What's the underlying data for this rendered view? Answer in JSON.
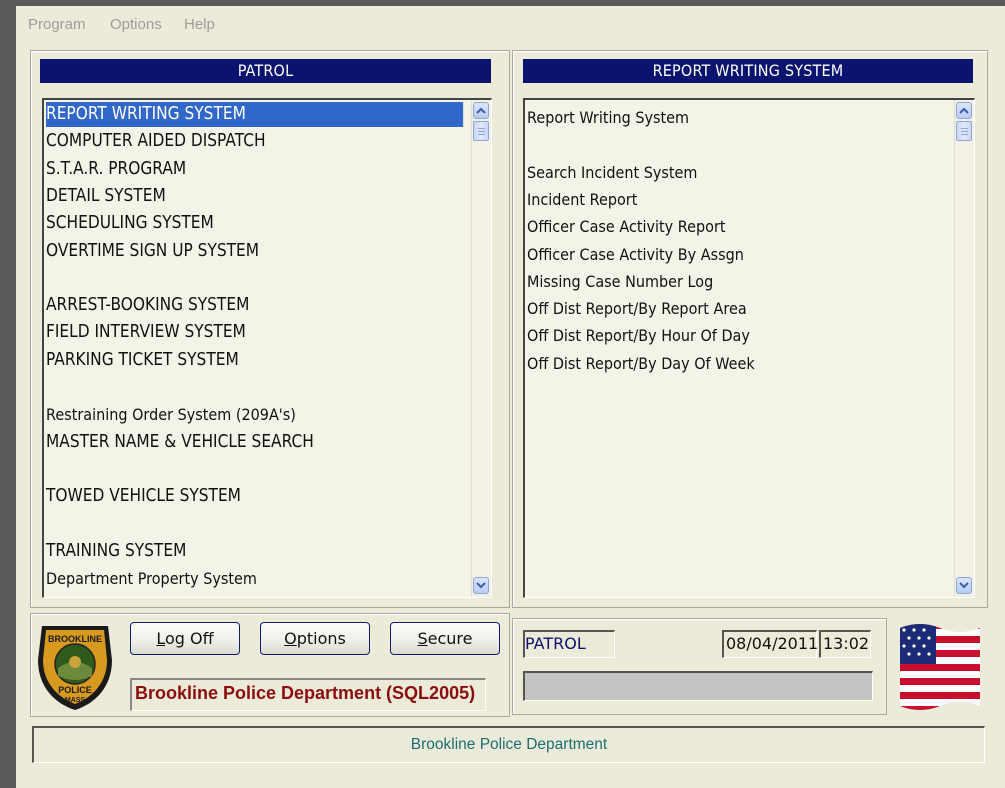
{
  "menu": [
    "Program",
    "Options",
    "Help"
  ],
  "left_panel": {
    "header": "PATROL",
    "items": [
      {
        "label": "REPORT WRITING SYSTEM",
        "selected": true
      },
      {
        "label": "COMPUTER AIDED DISPATCH"
      },
      {
        "label": "S.T.A.R. PROGRAM"
      },
      {
        "label": "DETAIL SYSTEM"
      },
      {
        "label": "SCHEDULING SYSTEM"
      },
      {
        "label": "OVERTIME SIGN UP SYSTEM"
      },
      {
        "label": ""
      },
      {
        "label": "ARREST-BOOKING SYSTEM"
      },
      {
        "label": "FIELD INTERVIEW SYSTEM"
      },
      {
        "label": "PARKING TICKET SYSTEM"
      },
      {
        "label": ""
      },
      {
        "label": "Restraining Order System (209A's)"
      },
      {
        "label": "MASTER NAME & VEHICLE SEARCH"
      },
      {
        "label": ""
      },
      {
        "label": "TOWED VEHICLE SYSTEM"
      },
      {
        "label": ""
      },
      {
        "label": "TRAINING SYSTEM"
      },
      {
        "label": "Department Property System"
      }
    ]
  },
  "right_panel": {
    "header": "REPORT WRITING SYSTEM",
    "items": [
      "Report Writing System",
      "",
      "Search Incident System",
      "Incident Report",
      "Officer Case Activity Report",
      "Officer Case Activity By Assgn",
      "Missing Case Number Log",
      "Off Dist Report/By Report Area",
      "Off Dist Report/By Hour Of Day",
      "Off Dist Report/By Day Of Week"
    ]
  },
  "buttons": {
    "logoff": {
      "underline": "L",
      "rest": "og Off"
    },
    "options": {
      "underline": "O",
      "rest": "ptions"
    },
    "secure": {
      "underline": "S",
      "rest": "ecure"
    }
  },
  "department_label": "Brookline Police Department (SQL2005)",
  "info": {
    "unit": "PATROL",
    "date": "08/04/2011",
    "time": "13:02",
    "message": ""
  },
  "status_bar": "Brookline Police Department",
  "badge": {
    "top_text": "BROOKLINE",
    "bottom_text": "POLICE",
    "sub_text": "MASS",
    "icon": "police-badge-icon"
  },
  "flag_icon": "us-flag-icon",
  "colors": {
    "header_bg": "#0a146e",
    "selection": "#3167c8",
    "dept_text": "#8b0d0d",
    "status_text": "#1a7070"
  }
}
